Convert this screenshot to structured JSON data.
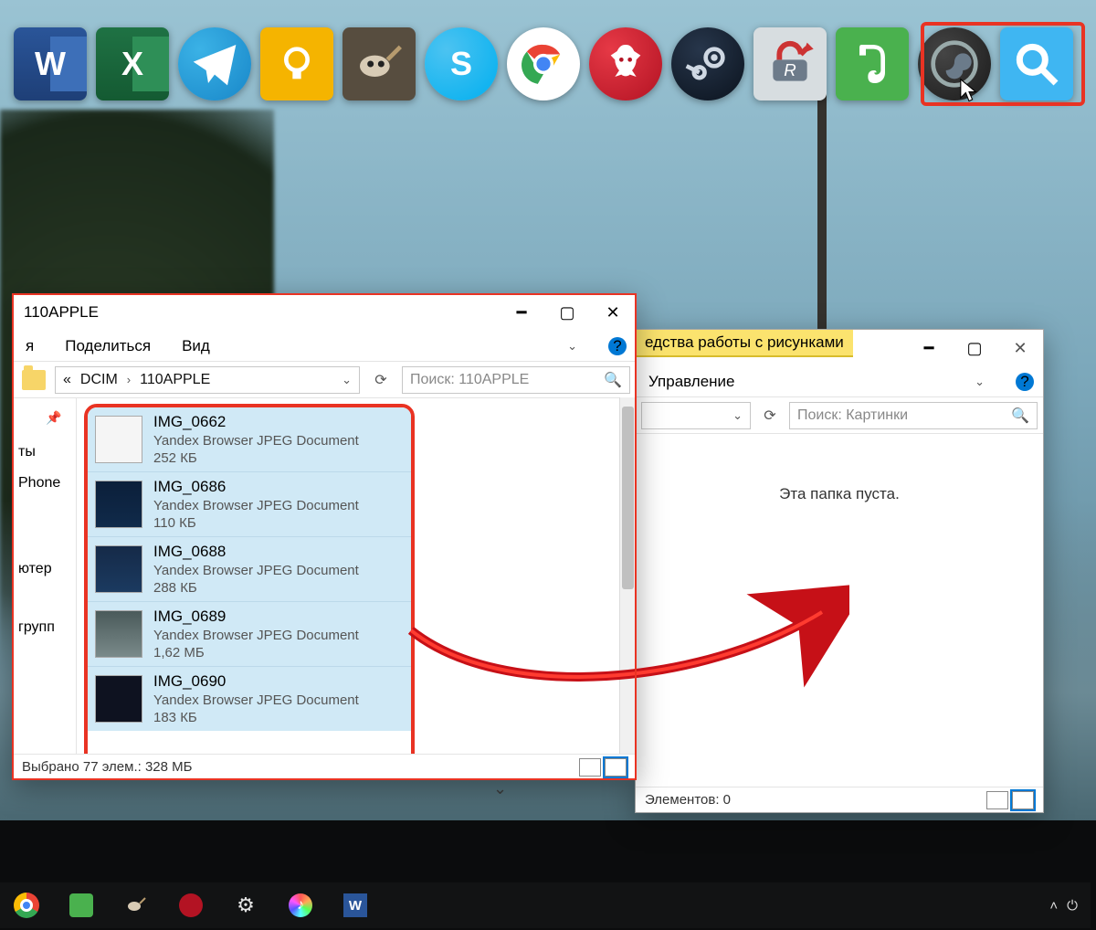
{
  "dock": {
    "icons": [
      "word-icon",
      "excel-icon",
      "telegram-icon",
      "keep-icon",
      "gimp-icon",
      "skype-icon",
      "chrome-icon",
      "daemon-tools-icon",
      "steam-icon",
      "reference-icon",
      "evernote-icon",
      "obs-icon",
      "magnifier-icon"
    ]
  },
  "left_window": {
    "title": "110APPLE",
    "tabs": {
      "share": "Поделиться",
      "view": "Вид",
      "partial_ya": "я"
    },
    "breadcrumb": {
      "prefix": "«",
      "p1": "DCIM",
      "p2": "110APPLE"
    },
    "search_placeholder": "Поиск: 110APPLE",
    "sidebar": {
      "ty": "ты",
      "phone": "Phone",
      "comp": "ютер",
      "group": "групп"
    },
    "files": [
      {
        "name": "IMG_0662",
        "type": "Yandex Browser JPEG Document",
        "size": "252 КБ",
        "thumb": "white"
      },
      {
        "name": "IMG_0686",
        "type": "Yandex Browser JPEG Document",
        "size": "110 КБ",
        "thumb": "dark1"
      },
      {
        "name": "IMG_0688",
        "type": "Yandex Browser JPEG Document",
        "size": "288 КБ",
        "thumb": "blue"
      },
      {
        "name": "IMG_0689",
        "type": "Yandex Browser JPEG Document",
        "size": "1,62 МБ",
        "thumb": "fog"
      },
      {
        "name": "IMG_0690",
        "type": "Yandex Browser JPEG Document",
        "size": "183 КБ",
        "thumb": "dark2"
      }
    ],
    "status": "Выбрано 77 элем.: 328 МБ"
  },
  "right_window": {
    "contextual": "едства работы с рисунками",
    "manage": "Управление",
    "search_placeholder": "Поиск: Картинки",
    "empty": "Эта папка пуста.",
    "status": "Элементов: 0"
  },
  "taskbar": {
    "icons": [
      "chrome-icon",
      "evernote-icon",
      "gimp-icon",
      "daemon-tools-icon",
      "settings-icon",
      "itunes-icon",
      "word-icon"
    ]
  }
}
